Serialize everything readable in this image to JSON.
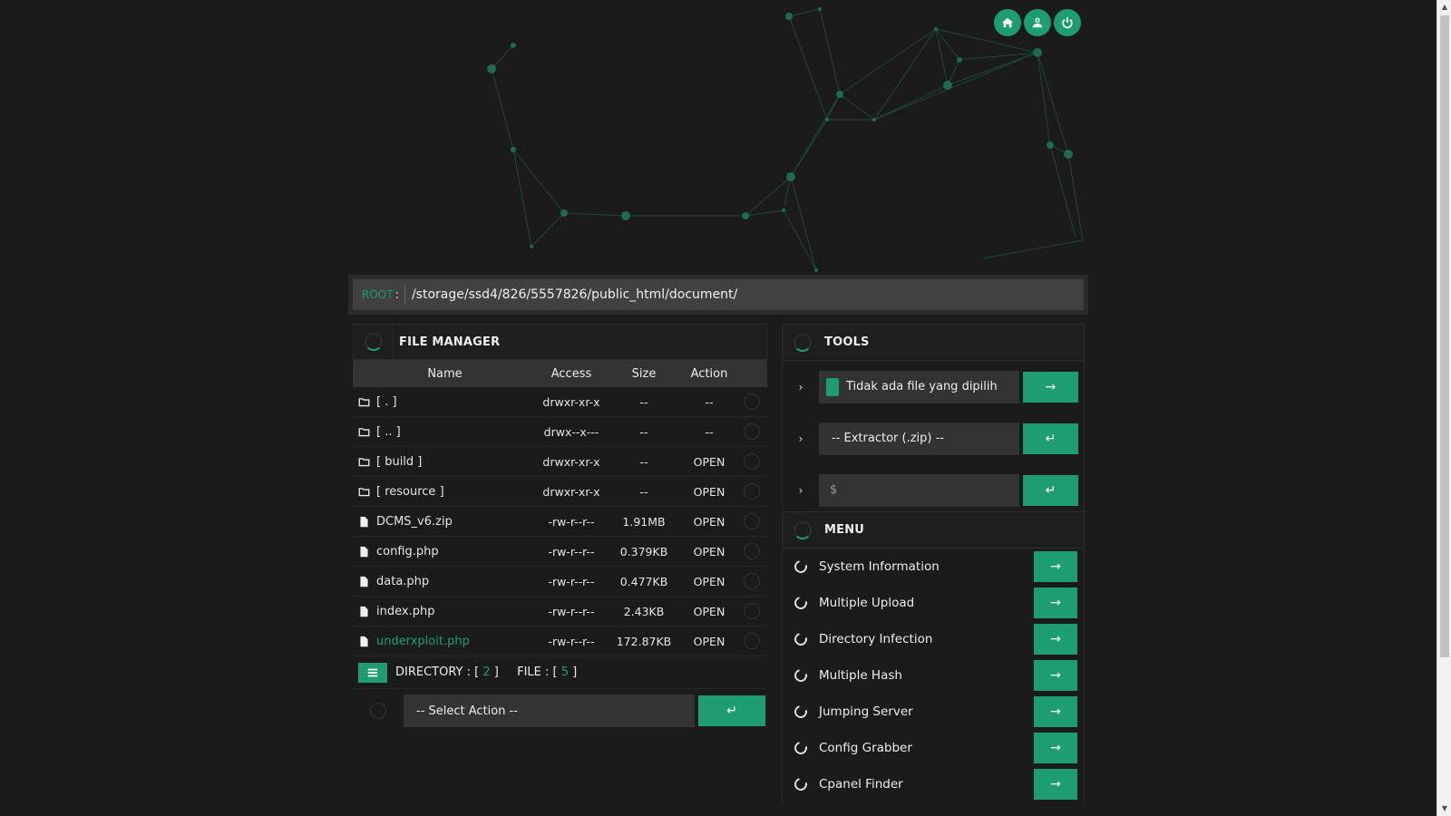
{
  "header": {
    "buttons": [
      {
        "name": "home-icon"
      },
      {
        "name": "user-icon"
      },
      {
        "name": "power-icon"
      }
    ]
  },
  "root": {
    "label": "ROOT",
    "colon": ":",
    "path": "/storage/ssd4/826/5557826/public_html/document/"
  },
  "file_manager": {
    "title": "FILE MANAGER",
    "columns": {
      "name": "Name",
      "access": "Access",
      "size": "Size",
      "action": "Action"
    },
    "rows": [
      {
        "type": "folder",
        "name": "[ . ]",
        "access": "drwxr-xr-x",
        "size": "--",
        "action": "--"
      },
      {
        "type": "folder",
        "name": "[ .. ]",
        "access": "drwx--x---",
        "size": "--",
        "action": "--"
      },
      {
        "type": "folder",
        "name": "[ build ]",
        "access": "drwxr-xr-x",
        "size": "--",
        "action": "OPEN"
      },
      {
        "type": "folder",
        "name": "[ resource ]",
        "access": "drwxr-xr-x",
        "size": "--",
        "action": "OPEN"
      },
      {
        "type": "file",
        "name": "DCMS_v6.zip",
        "access": "-rw-r--r--",
        "size": "1.91MB",
        "action": "OPEN"
      },
      {
        "type": "file",
        "name": "config.php",
        "access": "-rw-r--r--",
        "size": "0.379KB",
        "action": "OPEN"
      },
      {
        "type": "file",
        "name": "data.php",
        "access": "-rw-r--r--",
        "size": "0.477KB",
        "action": "OPEN"
      },
      {
        "type": "file",
        "name": "index.php",
        "access": "-rw-r--r--",
        "size": "2.43KB",
        "action": "OPEN"
      },
      {
        "type": "file",
        "name": "underxploit.php",
        "access": "-rw-r--r--",
        "size": "172.87KB",
        "action": "OPEN",
        "highlight": true
      }
    ],
    "footer": {
      "directory_label": "DIRECTORY : [",
      "directory_count": "2",
      "file_label": "FILE : [",
      "file_count": "5",
      "close_bracket": "]"
    },
    "select_action": "-- Select Action --",
    "submit_glyph": "↵"
  },
  "tools": {
    "title": "TOOLS",
    "upload_label": "Tidak ada file yang dipilih",
    "upload_btn": "→",
    "extractor_label": "-- Extractor (.zip) --",
    "extractor_btn": "↵",
    "command_prompt": "$",
    "command_btn": "↵",
    "chevron": "›"
  },
  "menu": {
    "title": "MENU",
    "items": [
      {
        "label": "System Information",
        "btn": "→"
      },
      {
        "label": "Multiple Upload",
        "btn": "→"
      },
      {
        "label": "Directory Infection",
        "btn": "→"
      },
      {
        "label": "Multiple Hash",
        "btn": "→"
      },
      {
        "label": "Jumping Server",
        "btn": "→"
      },
      {
        "label": "Config Grabber",
        "btn": "→"
      },
      {
        "label": "Cpanel Finder",
        "btn": "→"
      }
    ]
  },
  "colors": {
    "accent": "#1f9d72",
    "background": "#1b1b1b",
    "panel": "#333333"
  }
}
